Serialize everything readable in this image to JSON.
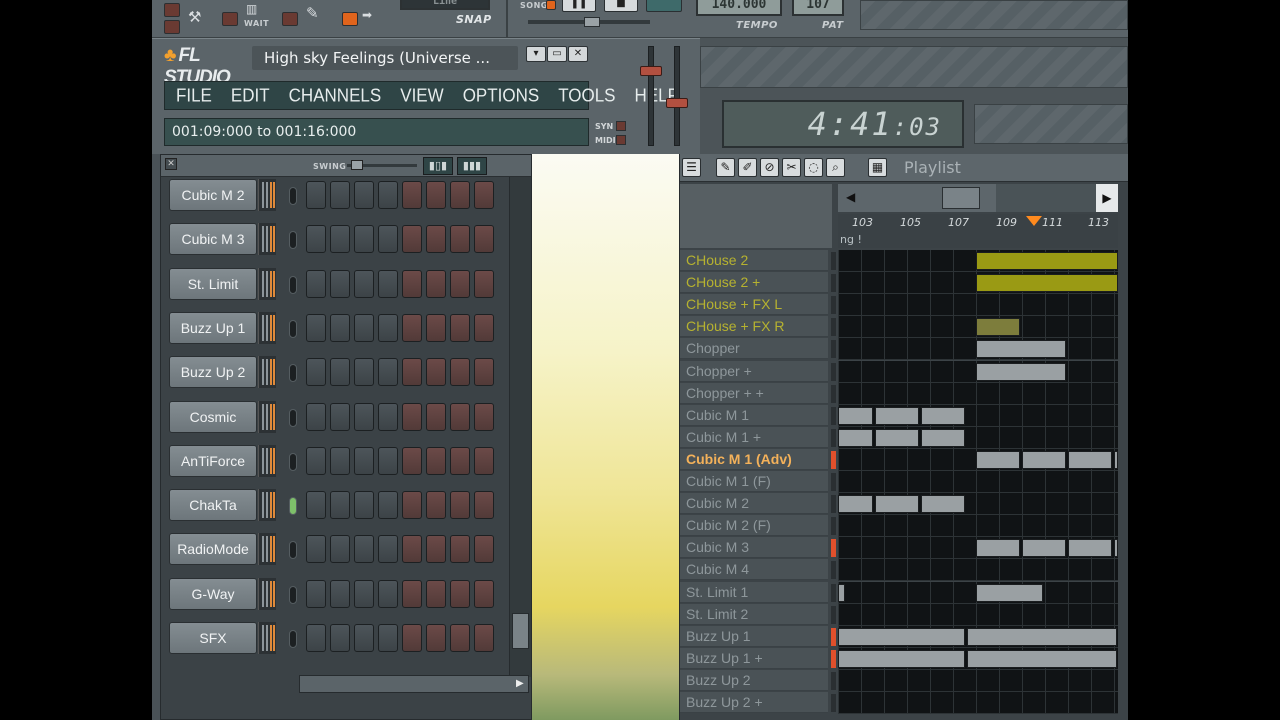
{
  "app": {
    "logo": "FL STUDIO",
    "song_title": "High sky Feelings (Universe ...",
    "menu": [
      "FILE",
      "EDIT",
      "CHANNELS",
      "VIEW",
      "OPTIONS",
      "TOOLS",
      "HELP"
    ],
    "hint": "001:09:000 to 001:16:000",
    "syn": "SYN",
    "midi": "MIDI",
    "clock_main": "4:41",
    "clock_small": ":03",
    "win_buttons": [
      "▾",
      "▭",
      "✕"
    ]
  },
  "topstrip": {
    "wait": "WAIT",
    "snap": "SNAP",
    "song": "SONG",
    "tempo_label": "TEMPO",
    "pat_label": "PAT",
    "tempo_value": "140.000",
    "pat_value": "107",
    "snap_value": "Line"
  },
  "rack": {
    "swing": "SWING",
    "channels": [
      {
        "name": "Cubic M 2",
        "led": false
      },
      {
        "name": "Cubic M 3",
        "led": false
      },
      {
        "name": "St. Limit",
        "led": false
      },
      {
        "name": "Buzz Up 1",
        "led": false
      },
      {
        "name": "Buzz Up 2",
        "led": false
      },
      {
        "name": "Cosmic",
        "led": false
      },
      {
        "name": "AnTiForce",
        "led": false
      },
      {
        "name": "ChakTa",
        "led": true
      },
      {
        "name": "RadioMode",
        "led": false
      },
      {
        "name": "G-Way",
        "led": false
      },
      {
        "name": "SFX",
        "led": false
      }
    ]
  },
  "playlist": {
    "title": "Playlist",
    "ruler": [
      "103",
      "105",
      "107",
      "109",
      "111",
      "113"
    ],
    "pattern_label": "ng !",
    "colors": {
      "olive": "#9a9a14",
      "olive_dim": "#7d7d3c",
      "gray": "#9aa0a3",
      "selected": "#f3b15a",
      "name_olive": "#b6b230",
      "name_gray": "#8e979b"
    },
    "tracks": [
      {
        "name": "CHouse 2",
        "style": "olive",
        "marker": false,
        "clips": [
          [
            3,
            8
          ]
        ]
      },
      {
        "name": "CHouse 2 +",
        "style": "olive",
        "marker": false,
        "clips": [
          [
            3,
            8
          ]
        ]
      },
      {
        "name": "CHouse + FX L",
        "style": "olive",
        "marker": false,
        "clips": []
      },
      {
        "name": "CHouse + FX R",
        "style": "olive",
        "marker": false,
        "clips": [
          [
            3,
            1
          ]
        ]
      },
      {
        "name": "Chopper",
        "style": "gray",
        "marker": false,
        "clips": [
          [
            3,
            2
          ]
        ]
      },
      {
        "name": "Chopper +",
        "style": "gray",
        "marker": false,
        "clips": [
          [
            3,
            2
          ]
        ]
      },
      {
        "name": "Chopper + +",
        "style": "gray",
        "marker": false,
        "clips": []
      },
      {
        "name": "Cubic M 1",
        "style": "gray",
        "marker": false,
        "clips": [
          [
            0,
            0.8
          ],
          [
            0.8,
            1
          ],
          [
            1.8,
            1
          ]
        ]
      },
      {
        "name": "Cubic M 1 +",
        "style": "gray",
        "marker": false,
        "clips": [
          [
            0,
            0.8
          ],
          [
            0.8,
            1
          ],
          [
            1.8,
            1
          ]
        ]
      },
      {
        "name": "Cubic M 1 (Adv)",
        "style": "selected",
        "marker": true,
        "clips": [
          [
            3,
            1
          ],
          [
            4,
            1
          ],
          [
            5,
            1
          ],
          [
            6,
            0.2
          ]
        ]
      },
      {
        "name": "Cubic M 1 (F)",
        "style": "gray",
        "marker": false,
        "clips": []
      },
      {
        "name": "Cubic M 2",
        "style": "gray",
        "marker": false,
        "clips": [
          [
            0,
            0.8
          ],
          [
            0.8,
            1
          ],
          [
            1.8,
            1
          ]
        ]
      },
      {
        "name": "Cubic M 2 (F)",
        "style": "gray",
        "marker": false,
        "clips": []
      },
      {
        "name": "Cubic M 3",
        "style": "gray",
        "marker": true,
        "clips": [
          [
            3,
            1
          ],
          [
            4,
            1
          ],
          [
            5,
            1
          ],
          [
            6,
            0.2
          ]
        ]
      },
      {
        "name": "Cubic M 4",
        "style": "gray",
        "marker": false,
        "clips": []
      },
      {
        "name": "St. Limit 1",
        "style": "gray",
        "marker": false,
        "clips": [
          [
            0,
            0.2
          ],
          [
            3,
            1.5
          ]
        ]
      },
      {
        "name": "St. Limit 2",
        "style": "gray",
        "marker": false,
        "clips": []
      },
      {
        "name": "Buzz Up 1",
        "style": "gray",
        "marker": true,
        "clips": [
          [
            0,
            2.8
          ],
          [
            2.8,
            3.3
          ]
        ]
      },
      {
        "name": "Buzz Up 1 +",
        "style": "gray",
        "marker": true,
        "clips": [
          [
            0,
            2.8
          ],
          [
            2.8,
            3.3
          ]
        ]
      },
      {
        "name": "Buzz Up 2",
        "style": "gray",
        "marker": false,
        "clips": []
      },
      {
        "name": "Buzz Up 2 +",
        "style": "gray",
        "marker": false,
        "clips": []
      }
    ]
  }
}
